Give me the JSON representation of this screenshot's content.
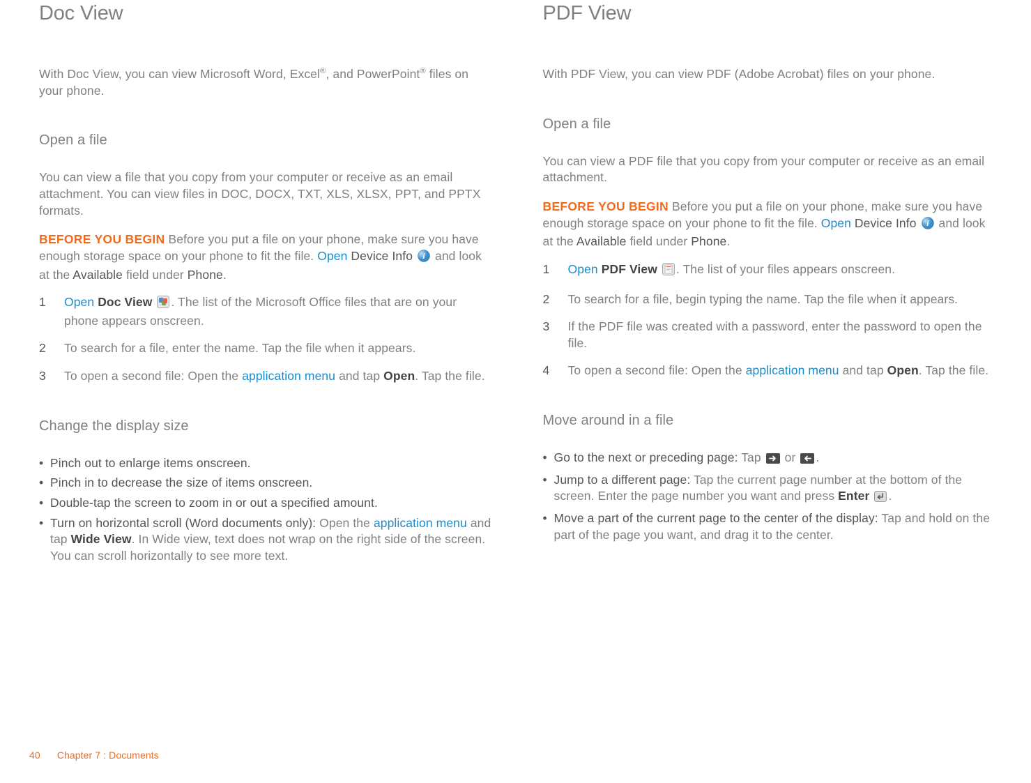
{
  "left": {
    "title": "Doc View",
    "intro_pre": "With Doc View, you can view Microsoft Word, Excel",
    "intro_mid": ", and PowerPoint",
    "intro_post": " files on your phone.",
    "sup": "®",
    "open_h": "Open a file",
    "open_p": "You can view a file that you copy from your computer or receive as an email attachment. You can view files in DOC, DOCX, TXT, XLS, XLSX, PPT, and PPTX formats.",
    "before_label": "BEFORE YOU BEGIN",
    "before_1": "  Before you put a file on your phone, make sure you have enough storage space on your phone to fit the file. ",
    "open_word": "Open",
    "device_info": "Device Info",
    "before_2": " and look at the ",
    "available": "Available",
    "before_3": " field under ",
    "phone": "Phone",
    "period": ".",
    "steps": {
      "n1": "1",
      "s1_open": "Open",
      "s1_dv": "Doc View",
      "s1_rest": ". The list of the Microsoft Office files that are on your phone appears onscreen.",
      "n2": "2",
      "s2": "To search for a file, enter the name. Tap the file when it appears.",
      "n3": "3",
      "s3_a": "To open a second file: Open the ",
      "s3_link": "application menu",
      "s3_b": " and tap ",
      "s3_open": "Open",
      "s3_c": ". Tap the file."
    },
    "change_h": "Change the display size",
    "bul": {
      "b1": "Pinch out to enlarge items onscreen.",
      "b2": "Pinch in to decrease the size of items onscreen.",
      "b3": "Double-tap the screen to zoom in or out a specified amount.",
      "b4_lead": "Turn on horizontal scroll (Word documents only): ",
      "b4_a": "Open the ",
      "b4_link": "application menu",
      "b4_b": " and tap ",
      "b4_wide": "Wide View",
      "b4_c": ". In Wide view, text does not wrap on the right side of the screen. You can scroll horizontally to see more text."
    }
  },
  "right": {
    "title": "PDF View",
    "intro": "With PDF View, you can view PDF (Adobe Acrobat) files on your phone.",
    "open_h": "Open a file",
    "open_p": "You can view a PDF file that you copy from your computer or receive as an email attachment.",
    "before_label": "BEFORE YOU BEGIN",
    "before_1": "  Before you put a file on your phone, make sure you have enough storage space on your phone to fit the file. ",
    "open_word": "Open",
    "device_info": "Device Info",
    "before_2": " and look at the ",
    "available": "Available",
    "before_3": " field under ",
    "phone": "Phone",
    "period": ".",
    "steps": {
      "n1": "1",
      "s1_open": "Open",
      "s1_pv": "PDF View",
      "s1_rest": ". The list of your files appears onscreen.",
      "n2": "2",
      "s2": "To search for a file, begin typing the name. Tap the file when it appears.",
      "n3": "3",
      "s3": "If the PDF file was created with a password, enter the password to open the file.",
      "n4": "4",
      "s4_a": "To open a second file: Open the ",
      "s4_link": "application menu",
      "s4_b": " and tap ",
      "s4_open": "Open",
      "s4_c": ". Tap the file."
    },
    "move_h": "Move around in a file",
    "bul": {
      "b1_lead": "Go to the next or preceding page: ",
      "b1_a": "Tap ",
      "b1_or": " or ",
      "b1_end": ".",
      "b2_lead": "Jump to a different page: ",
      "b2_a": "Tap the current page number at the bottom of the screen. Enter the page number you want and press ",
      "b2_enter": "Enter",
      "b2_end": ".",
      "b3_lead": "Move a part of the current page to the center of the display: ",
      "b3_a": "Tap and hold on the part of the page you want, and drag it to the center."
    }
  },
  "footer": {
    "page": "40",
    "chapter": "Chapter 7 : Documents"
  }
}
